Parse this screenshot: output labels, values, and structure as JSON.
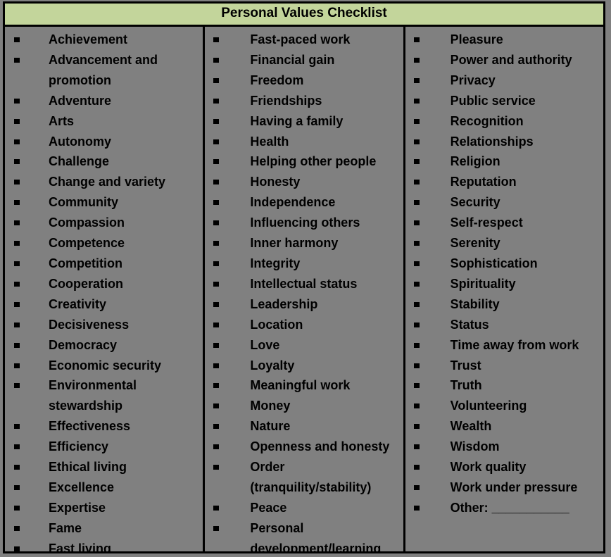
{
  "document": {
    "title": "Personal Values Checklist",
    "bullet_icon": "square-bullet-icon",
    "colors": {
      "title_background": "#c3d59b",
      "body_background": "#808080",
      "border": "#000000",
      "text": "#000000"
    }
  },
  "columns": [
    {
      "id": "column-1",
      "items": [
        "Achievement",
        "Advancement and promotion",
        "Adventure",
        "Arts",
        "Autonomy",
        "Challenge",
        "Change and variety",
        "Community",
        "Compassion",
        "Competence",
        "Competition",
        "Cooperation",
        "Creativity",
        "Decisiveness",
        "Democracy",
        "Economic security",
        "Environmental stewardship",
        "Effectiveness",
        "Efficiency",
        "Ethical living",
        "Excellence",
        "Expertise",
        "Fame",
        "Fast living"
      ]
    },
    {
      "id": "column-2",
      "items": [
        "Fast-paced work",
        "Financial gain",
        "Freedom",
        "Friendships",
        "Having a family",
        "Health",
        "Helping other people",
        "Honesty",
        "Independence",
        "Influencing others",
        "Inner harmony",
        "Integrity",
        "Intellectual status",
        "Leadership",
        "Location",
        "Love",
        "Loyalty",
        "Meaningful work",
        "Money",
        "Nature",
        "Openness and honesty",
        "Order (tranquility/stability)",
        "Peace",
        "Personal development/learning"
      ]
    },
    {
      "id": "column-3",
      "items": [
        "Pleasure",
        "Power and authority",
        "Privacy",
        "Public service",
        "Recognition",
        "Relationships",
        "Religion",
        "Reputation",
        "Security",
        "Self-respect",
        "Serenity",
        "Sophistication",
        "Spirituality",
        "Stability",
        "Status",
        "Time away from work",
        "Trust",
        "Truth",
        "Volunteering",
        "Wealth",
        "Wisdom",
        "Work quality",
        "Work under pressure",
        "Other: ___________"
      ]
    }
  ]
}
